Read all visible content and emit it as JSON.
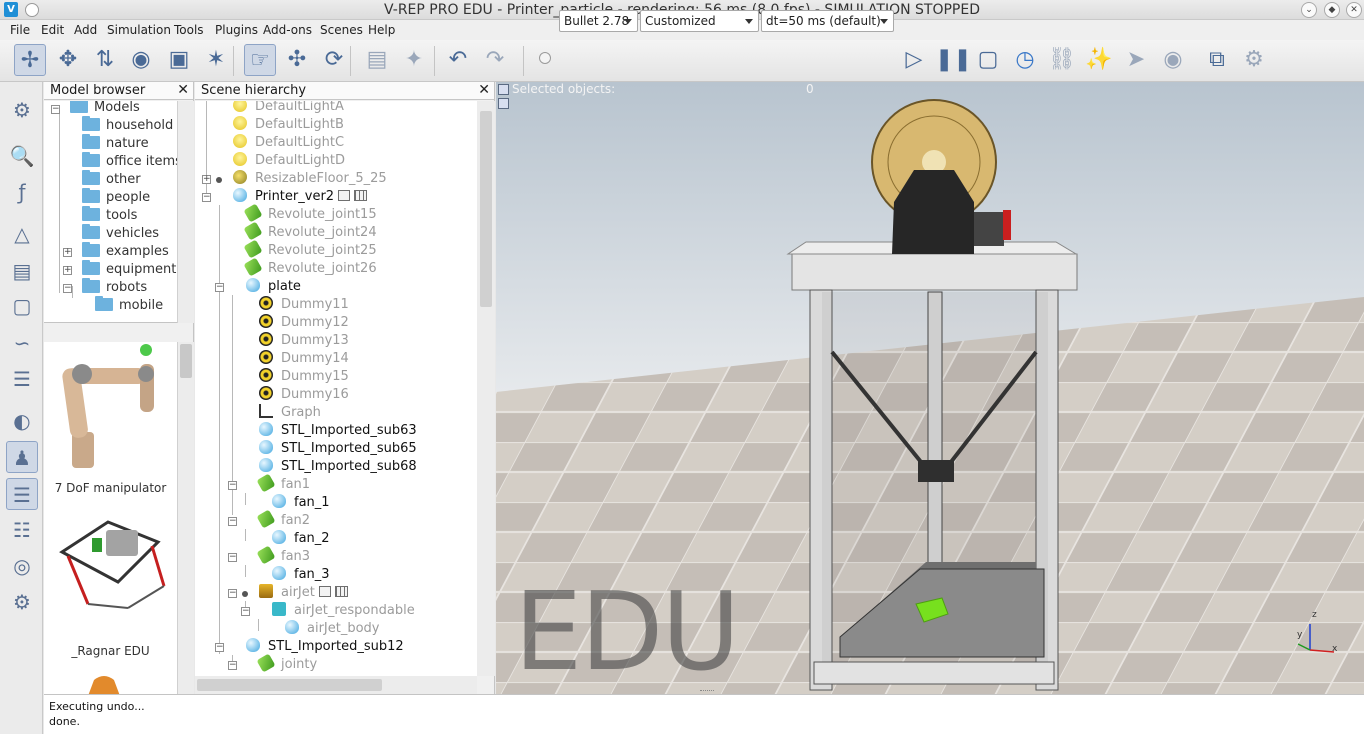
{
  "window": {
    "title": "V-REP PRO EDU - Printer_particle - rendering: 56 ms (8.0 fps) - SIMULATION STOPPED",
    "app_icon": "vrep-icon",
    "controls": [
      "minimize-icon",
      "restore-icon",
      "close-icon"
    ]
  },
  "menubar": {
    "items": [
      "File",
      "Edit",
      "Add",
      "Simulation",
      "Tools",
      "Plugins",
      "Add-ons",
      "Scenes",
      "Help"
    ]
  },
  "toolbar": {
    "engine": "Bullet 2.78",
    "accuracy": "Customized",
    "timestep": "dt=50 ms (default)",
    "icons": [
      "camera-pan-icon",
      "camera-rotate-icon",
      "camera-shift-icon",
      "camera-angle-icon",
      "fit-to-view-icon",
      "manipulate-icon",
      "click-select-icon",
      "object-shift-icon",
      "object-rotate-icon",
      "assemble-icon",
      "transfer-dna-icon",
      "undo-icon",
      "redo-icon",
      "start-icon",
      "pause-icon",
      "stop-icon",
      "realtime-icon",
      "slow-down-icon",
      "speed-up-icon",
      "thread-icon",
      "visualization-icon",
      "page-selector-icon",
      "scene-selector-icon"
    ]
  },
  "model_browser": {
    "header": "Model browser",
    "tree": [
      {
        "label": "Models",
        "level": 0,
        "expander": "minus"
      },
      {
        "label": "household",
        "level": 1
      },
      {
        "label": "nature",
        "level": 1
      },
      {
        "label": "office items",
        "level": 1
      },
      {
        "label": "other",
        "level": 1
      },
      {
        "label": "people",
        "level": 1
      },
      {
        "label": "tools",
        "level": 1
      },
      {
        "label": "vehicles",
        "level": 1
      },
      {
        "label": "examples",
        "level": 1,
        "expander": "plus"
      },
      {
        "label": "equipment",
        "level": 1,
        "expander": "plus"
      },
      {
        "label": "robots",
        "level": 1,
        "expander": "minus"
      },
      {
        "label": "mobile",
        "level": 2
      }
    ],
    "thumbnails": [
      "7 DoF manipulator",
      "_Ragnar EDU"
    ]
  },
  "scene_hierarchy": {
    "header": "Scene hierarchy",
    "items": [
      {
        "label": "DefaultLightA",
        "icon": "light",
        "dim": true
      },
      {
        "label": "DefaultLightB",
        "icon": "light",
        "dim": true
      },
      {
        "label": "DefaultLightC",
        "icon": "light",
        "dim": true
      },
      {
        "label": "DefaultLightD",
        "icon": "light",
        "dim": true
      },
      {
        "label": "ResizableFloor_5_25",
        "icon": "floor",
        "dim": true
      },
      {
        "label": "Printer_ver2",
        "icon": "shape",
        "dim": false
      },
      {
        "label": "Revolute_joint15",
        "icon": "joint",
        "dim": true
      },
      {
        "label": "Revolute_joint24",
        "icon": "joint",
        "dim": true
      },
      {
        "label": "Revolute_joint25",
        "icon": "joint",
        "dim": true
      },
      {
        "label": "Revolute_joint26",
        "icon": "joint",
        "dim": true
      },
      {
        "label": "plate",
        "icon": "shape",
        "dim": false
      },
      {
        "label": "Dummy11",
        "icon": "dummy",
        "dim": true
      },
      {
        "label": "Dummy12",
        "icon": "dummy",
        "dim": true
      },
      {
        "label": "Dummy13",
        "icon": "dummy",
        "dim": true
      },
      {
        "label": "Dummy14",
        "icon": "dummy",
        "dim": true
      },
      {
        "label": "Dummy15",
        "icon": "dummy",
        "dim": true
      },
      {
        "label": "Dummy16",
        "icon": "dummy",
        "dim": true
      },
      {
        "label": "Graph",
        "icon": "graph",
        "dim": true
      },
      {
        "label": "STL_Imported_sub63",
        "icon": "shape",
        "dim": false
      },
      {
        "label": "STL_Imported_sub65",
        "icon": "shape",
        "dim": false
      },
      {
        "label": "STL_Imported_sub68",
        "icon": "shape",
        "dim": false
      },
      {
        "label": "fan1",
        "icon": "joint",
        "dim": true
      },
      {
        "label": "fan_1",
        "icon": "shape",
        "dim": false
      },
      {
        "label": "fan2",
        "icon": "joint",
        "dim": true
      },
      {
        "label": "fan_2",
        "icon": "shape",
        "dim": false
      },
      {
        "label": "fan3",
        "icon": "joint",
        "dim": true
      },
      {
        "label": "fan_3",
        "icon": "shape",
        "dim": false
      },
      {
        "label": "airJet",
        "icon": "airjet",
        "dim": true
      },
      {
        "label": "airJet_respondable",
        "icon": "cube",
        "dim": true
      },
      {
        "label": "airJet_body",
        "icon": "shape",
        "dim": true
      },
      {
        "label": "STL_Imported_sub12",
        "icon": "shape",
        "dim": false
      },
      {
        "label": "jointy",
        "icon": "joint",
        "dim": true
      }
    ]
  },
  "viewport": {
    "selected_label": "Selected objects:",
    "selected_count": "0",
    "watermark": "EDU",
    "axes": [
      "x",
      "y",
      "z"
    ]
  },
  "status": {
    "lines": [
      "Executing undo...",
      "done."
    ]
  },
  "colors": {
    "selection_blue": "#cfd8e6",
    "folder_blue": "#6db2de",
    "floor_light": "#d6d0c8",
    "floor_dark": "#9a948c",
    "printer_frame": "#d9d9d9",
    "filament_spool": "#d8b870",
    "print_part": "#77e01e"
  }
}
